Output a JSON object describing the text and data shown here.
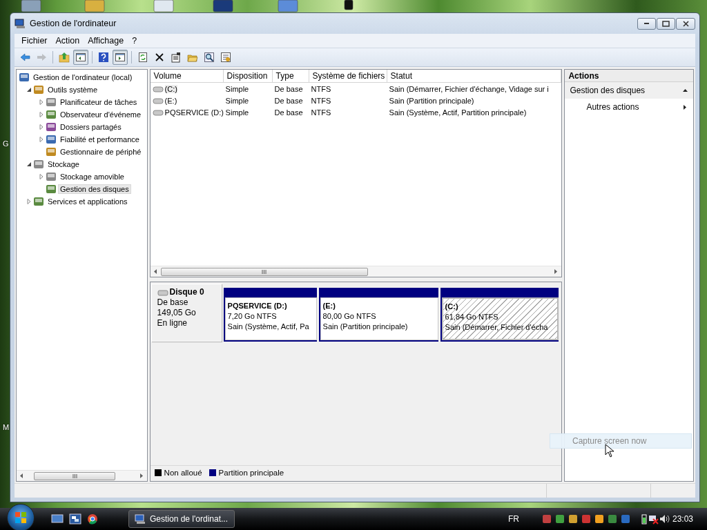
{
  "desktop_labels": [
    "G",
    "M"
  ],
  "window": {
    "title": "Gestion de l'ordinateur"
  },
  "menu": [
    "Fichier",
    "Action",
    "Affichage",
    "?"
  ],
  "toolbar": [
    {
      "pressed": false,
      "disabled": false
    },
    {
      "pressed": false,
      "disabled": true
    },
    {
      "pressed": false,
      "disabled": false
    },
    {
      "pressed": true,
      "disabled": false
    },
    {
      "pressed": false,
      "disabled": false
    },
    {
      "pressed": true,
      "disabled": false
    },
    {
      "pressed": false,
      "disabled": false
    },
    {
      "pressed": false,
      "disabled": false
    },
    {
      "pressed": false,
      "disabled": false
    },
    {
      "pressed": false,
      "disabled": false
    },
    {
      "pressed": false,
      "disabled": false
    },
    {
      "pressed": false,
      "disabled": false
    }
  ],
  "tree": [
    {
      "label": "Gestion de l'ordinateur (local)",
      "selected": false,
      "children": [
        {
          "label": "Outils système",
          "expanded": true,
          "selected": false,
          "children": [
            {
              "label": "Planificateur de tâches",
              "expanded": false,
              "selected": false
            },
            {
              "label": "Observateur d'événeme",
              "expanded": false,
              "selected": false
            },
            {
              "label": "Dossiers partagés",
              "expanded": false,
              "selected": false
            },
            {
              "label": "Fiabilité et performance",
              "expanded": false,
              "selected": false
            },
            {
              "label": "Gestionnaire de périphé",
              "selected": false
            }
          ]
        },
        {
          "label": "Stockage",
          "expanded": true,
          "selected": false,
          "children": [
            {
              "label": "Stockage amovible",
              "expanded": false,
              "selected": false
            },
            {
              "label": "Gestion des disques",
              "selected": true
            }
          ]
        },
        {
          "label": "Services et applications",
          "expanded": false,
          "selected": false
        }
      ]
    }
  ],
  "volumes": {
    "columns": [
      "Volume",
      "Disposition",
      "Type",
      "Système de fichiers",
      "Statut"
    ],
    "rows": [
      {
        "selected": true,
        "cells": [
          "(C:)",
          "Simple",
          "De base",
          "NTFS",
          "Sain (Démarrer, Fichier d'échange, Vidage sur i"
        ]
      },
      {
        "selected": false,
        "cells": [
          "(E:)",
          "Simple",
          "De base",
          "NTFS",
          "Sain (Partition principale)"
        ]
      },
      {
        "selected": false,
        "cells": [
          "PQSERVICE (D:)",
          "Simple",
          "De base",
          "NTFS",
          "Sain (Système, Actif, Partition principale)"
        ]
      }
    ]
  },
  "disk": {
    "name": "Disque 0",
    "type": "De base",
    "size": "149,05 Go",
    "status": "En ligne",
    "partitions": [
      {
        "label": "PQSERVICE  (D:)",
        "size": "7,20 Go NTFS",
        "status": "Sain (Système, Actif, Pa",
        "selected": false
      },
      {
        "label": "(E:)",
        "size": "80,00 Go NTFS",
        "status": "Sain (Partition principale)",
        "selected": false
      },
      {
        "label": "(C:)",
        "size": "61,84 Go NTFS",
        "status": "Sain (Démarrer, Fichier d'écha",
        "selected": true
      }
    ]
  },
  "legend": [
    {
      "label": "Non alloué",
      "color": "#000000"
    },
    {
      "label": "Partition principale",
      "color": "#000080"
    }
  ],
  "actions": {
    "title": "Actions",
    "section": {
      "label": "Gestion des disques",
      "expanded": true,
      "items": [
        "Autres actions"
      ]
    }
  },
  "capture_button": "Capture screen now",
  "taskbar": {
    "task": "Gestion de l'ordinat...",
    "language": "FR",
    "clock": "23:03"
  }
}
